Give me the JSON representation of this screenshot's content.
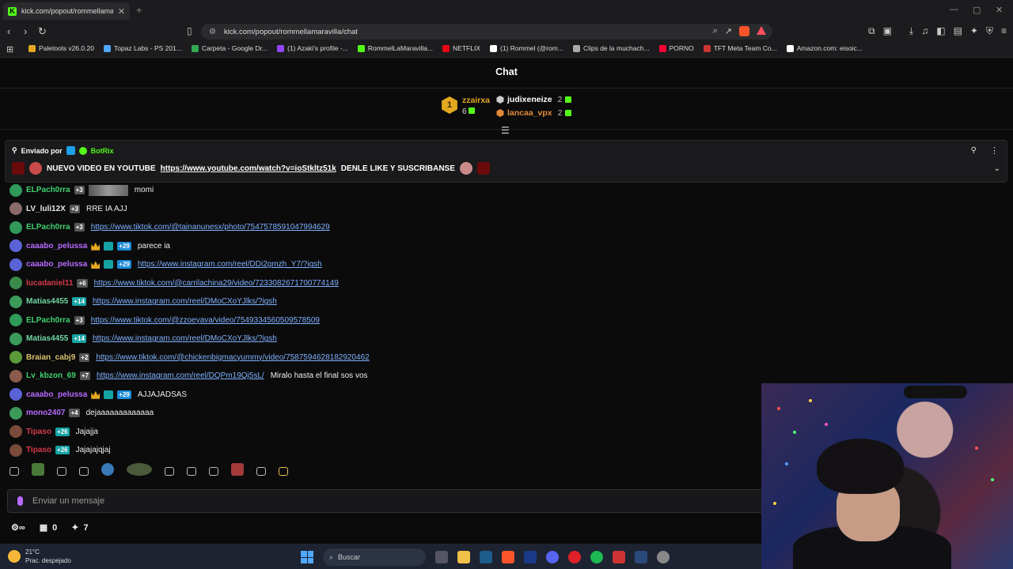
{
  "browser": {
    "tab_title": "kick.com/popout/rommellamarav",
    "url": "kick.com/popout/rommellamaravilla/chat",
    "bookmarks": [
      {
        "label": "Paletools v26.0.20",
        "color": "#e4a820"
      },
      {
        "label": "Topaz Labs - PS 201...",
        "color": "#4fa9ff"
      },
      {
        "label": "Carpeta - Google Dr...",
        "color": "#34a853"
      },
      {
        "label": "(1) Azaki's profile -...",
        "color": "#9146ff"
      },
      {
        "label": "RommelLaMaravilla...",
        "color": "#53fc18"
      },
      {
        "label": "NETFLIX",
        "color": "#e50914"
      },
      {
        "label": "(1) Rommel (@rom...",
        "color": "#ffffff"
      },
      {
        "label": "Clips de la muchach...",
        "color": "#aaaaaa"
      },
      {
        "label": "PORNO",
        "color": "#ff0033"
      },
      {
        "label": "TFT Meta Team Co...",
        "color": "#cc3333"
      },
      {
        "label": "Amazon.com: eisoic...",
        "color": "#ffffff"
      }
    ]
  },
  "chat": {
    "title": "Chat",
    "leaderboard": {
      "first": {
        "rank": "1",
        "name": "zzairxa",
        "count": "6"
      },
      "second": {
        "name": "judixeneize",
        "count": "2"
      },
      "third": {
        "name": "lancaa_vpx",
        "count": "2"
      }
    },
    "pinned": {
      "sent_by_label": "Enviado por",
      "sender": "BotRix",
      "message_prefix": "NUEVO VIDEO EN YOUTUBE",
      "link": "https://www.youtube.com/watch?v=ioStkltz51k",
      "message_suffix": "DENLE LIKE Y SUSCRIBANSE"
    },
    "messages": [
      {
        "user": "ELPach0rra",
        "color": "#3fd16f",
        "badges": [
          "+3"
        ],
        "text": "momi",
        "link": "",
        "avatar": "#2f9a5a",
        "partial": true
      },
      {
        "user": "LV_luli12X",
        "color": "#e6e6e6",
        "badges": [
          "+3"
        ],
        "text": "RRE IA AJJ",
        "link": "",
        "avatar": "#8a6a6a"
      },
      {
        "user": "ELPach0rra",
        "color": "#3fd16f",
        "badges": [
          "+3"
        ],
        "text": "",
        "link": "https://www.tiktok.com/@tainanunesx/photo/7547578591047994629",
        "avatar": "#2f9a5a"
      },
      {
        "user": "caaabo_pelussa",
        "color": "#b86bff",
        "badges": [
          "crown",
          "chart",
          "+29"
        ],
        "text": "parece ia",
        "link": "",
        "avatar": "#5a63d6"
      },
      {
        "user": "caaabo_pelussa",
        "color": "#b86bff",
        "badges": [
          "crown",
          "chart",
          "+29"
        ],
        "text": "",
        "link": "https://www.instagram.com/reel/DDi2gmzh_Y7/?igsh",
        "avatar": "#5a63d6"
      },
      {
        "user": "lucadaniel11",
        "color": "#d63a4a",
        "badges": [
          "+6"
        ],
        "text": "",
        "link": "https://www.tiktok.com/@carrilachina29/video/7233082671700774149",
        "avatar": "#3b8a4a"
      },
      {
        "user": "Matias4455",
        "color": "#6fd6a0",
        "badges": [
          "+14"
        ],
        "text": "",
        "link": "https://www.instagram.com/reel/DMoCXoYJlks/?igsh",
        "avatar": "#3b9a5a"
      },
      {
        "user": "ELPach0rra",
        "color": "#3fd16f",
        "badges": [
          "+3"
        ],
        "text": "",
        "link": "https://www.tiktok.com/@zzoeyava/video/7549334560509578509",
        "avatar": "#2f9a5a"
      },
      {
        "user": "Matias4455",
        "color": "#6fd6a0",
        "badges": [
          "+14"
        ],
        "text": "",
        "link": "https://www.instagram.com/reel/DMoCXoYJlks/?igsh",
        "avatar": "#3b9a5a"
      },
      {
        "user": "Braian_cabj9",
        "color": "#d6c36a",
        "badges": [
          "+2"
        ],
        "text": "",
        "link": "https://www.tiktok.com/@chickenbigmacyummy/video/7587594628182920462",
        "avatar": "#5a9a3a"
      },
      {
        "user": "Lv_kbzon_69",
        "color": "#3fd16f",
        "badges": [
          "+7"
        ],
        "text": "Miralo hasta el final sos vos",
        "link": "https://www.instagram.com/reel/DQPm19Qj5sL/",
        "avatar": "#8a5a4a"
      },
      {
        "user": "caaabo_pelussa",
        "color": "#b86bff",
        "badges": [
          "crown",
          "chart",
          "+29"
        ],
        "text": "AJJAJADSAS",
        "link": "",
        "avatar": "#5a63d6"
      },
      {
        "user": "mono2407",
        "color": "#b86bff",
        "badges": [
          "+4"
        ],
        "text": "dejaaaaaaaaaaaaa",
        "link": "",
        "avatar": "#3b9a5a"
      },
      {
        "user": "Tipaso",
        "color": "#d63a4a",
        "badges": [
          "+26"
        ],
        "text": "Jajajja",
        "link": "",
        "avatar": "#7a4a3a"
      },
      {
        "user": "Tipaso",
        "color": "#d63a4a",
        "badges": [
          "+26"
        ],
        "text": "Jajajajqjaj",
        "link": "",
        "avatar": "#7a4a3a"
      }
    ],
    "input_placeholder": "Enviar un mensaje",
    "footer": {
      "points": "0",
      "kicks": "7"
    }
  },
  "taskbar": {
    "temperature": "21°C",
    "weather": "Prac. despejado",
    "search_label": "Buscar"
  }
}
